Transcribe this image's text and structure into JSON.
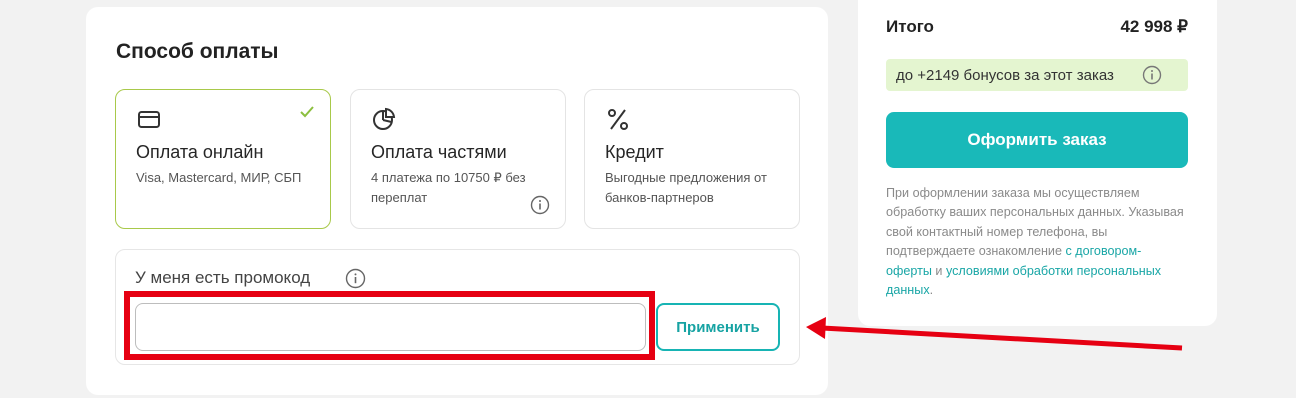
{
  "payment": {
    "title": "Способ оплаты",
    "options": [
      {
        "label": "Оплата онлайн",
        "desc": "Visa, Mastercard, МИР, СБП",
        "icon": "credit-card-icon",
        "selected": true
      },
      {
        "label": "Оплата частями",
        "desc": "4 платежа по 10750 ₽ без переплат",
        "icon": "pie-chart-icon",
        "selected": false
      },
      {
        "label": "Кредит",
        "desc": "Выгодные предложения от банков-партнеров",
        "icon": "percent-icon",
        "selected": false
      }
    ]
  },
  "promo": {
    "label": "У меня есть промокод",
    "value": "",
    "placeholder": "",
    "apply_label": "Применить"
  },
  "summary": {
    "total_label": "Итого",
    "total_value": "42 998 ₽",
    "bonus_text": "до +2149 бонусов за этот заказ",
    "order_button": "Оформить заказ",
    "disclaimer_prefix": "При оформлении заказа мы осуществляем обработку ваших персональных данных. Указывая свой контактный номер телефона, вы подтверждаете ознакомление",
    "disclaimer_link1": "с договором-оферты",
    "disclaimer_and": " и ",
    "disclaimer_link2": "условиями обработки персональных данных",
    "disclaimer_end": "."
  },
  "colors": {
    "accent": "#19b9b9",
    "selected_border": "#a8c94a",
    "bonus_bg": "#e4f5d0",
    "highlight": "#e60012"
  }
}
